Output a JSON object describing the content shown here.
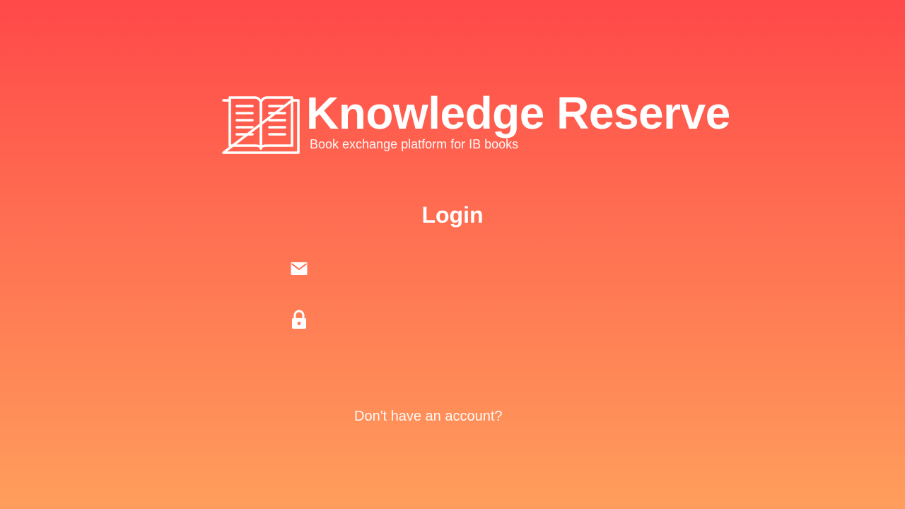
{
  "brand": {
    "title": "Knowledge Reserve",
    "subtitle": "Book exchange platform for IB books",
    "logo_icon": "open-book-icon"
  },
  "login": {
    "heading": "Login",
    "email": {
      "icon": "mail-icon",
      "value": "",
      "placeholder": ""
    },
    "password": {
      "icon": "lock-icon",
      "value": "",
      "placeholder": ""
    },
    "signup_prompt": "Don't have an account?"
  },
  "colors": {
    "gradient_top": "#ff4949",
    "gradient_bottom": "#ff9e5c",
    "text": "#ffffff"
  }
}
